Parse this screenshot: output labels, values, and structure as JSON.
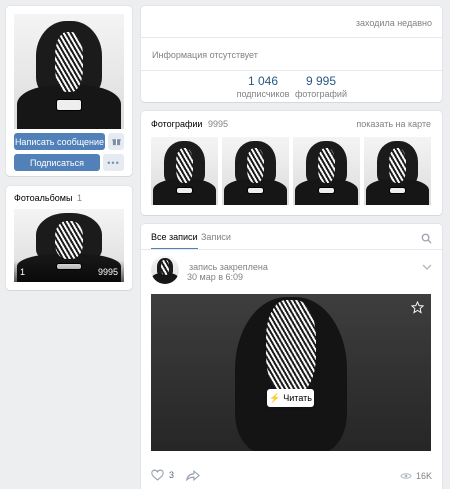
{
  "profile": {
    "message_button": "Написать сообщение",
    "gift_icon": "gift-icon",
    "subscribe_button": "Подписаться",
    "more_icon": "more-icon"
  },
  "albums": {
    "title": "Фотоальбомы",
    "count": "1",
    "album_index": "1",
    "album_photo_count": "9995"
  },
  "info": {
    "last_seen": "заходила недавно",
    "no_info": "Информация отсутствует",
    "stats": [
      {
        "value": "1 046",
        "label": "подписчиков"
      },
      {
        "value": "9 995",
        "label": "фотографий"
      }
    ]
  },
  "photos": {
    "title": "Фотографии",
    "count": "9995",
    "map_link": "показать на карте"
  },
  "wall": {
    "tabs": [
      "Все записи",
      "Записи"
    ],
    "search_icon": "search-icon",
    "post": {
      "pinned": "запись закреплена",
      "date": "30 мар в 6:09",
      "read_button": "Читать",
      "likes": "3",
      "views": "16K"
    }
  },
  "colors": {
    "background": "#edeef0",
    "primary_button": "#5181b8",
    "link": "#2a5885",
    "muted_text": "#828282"
  }
}
